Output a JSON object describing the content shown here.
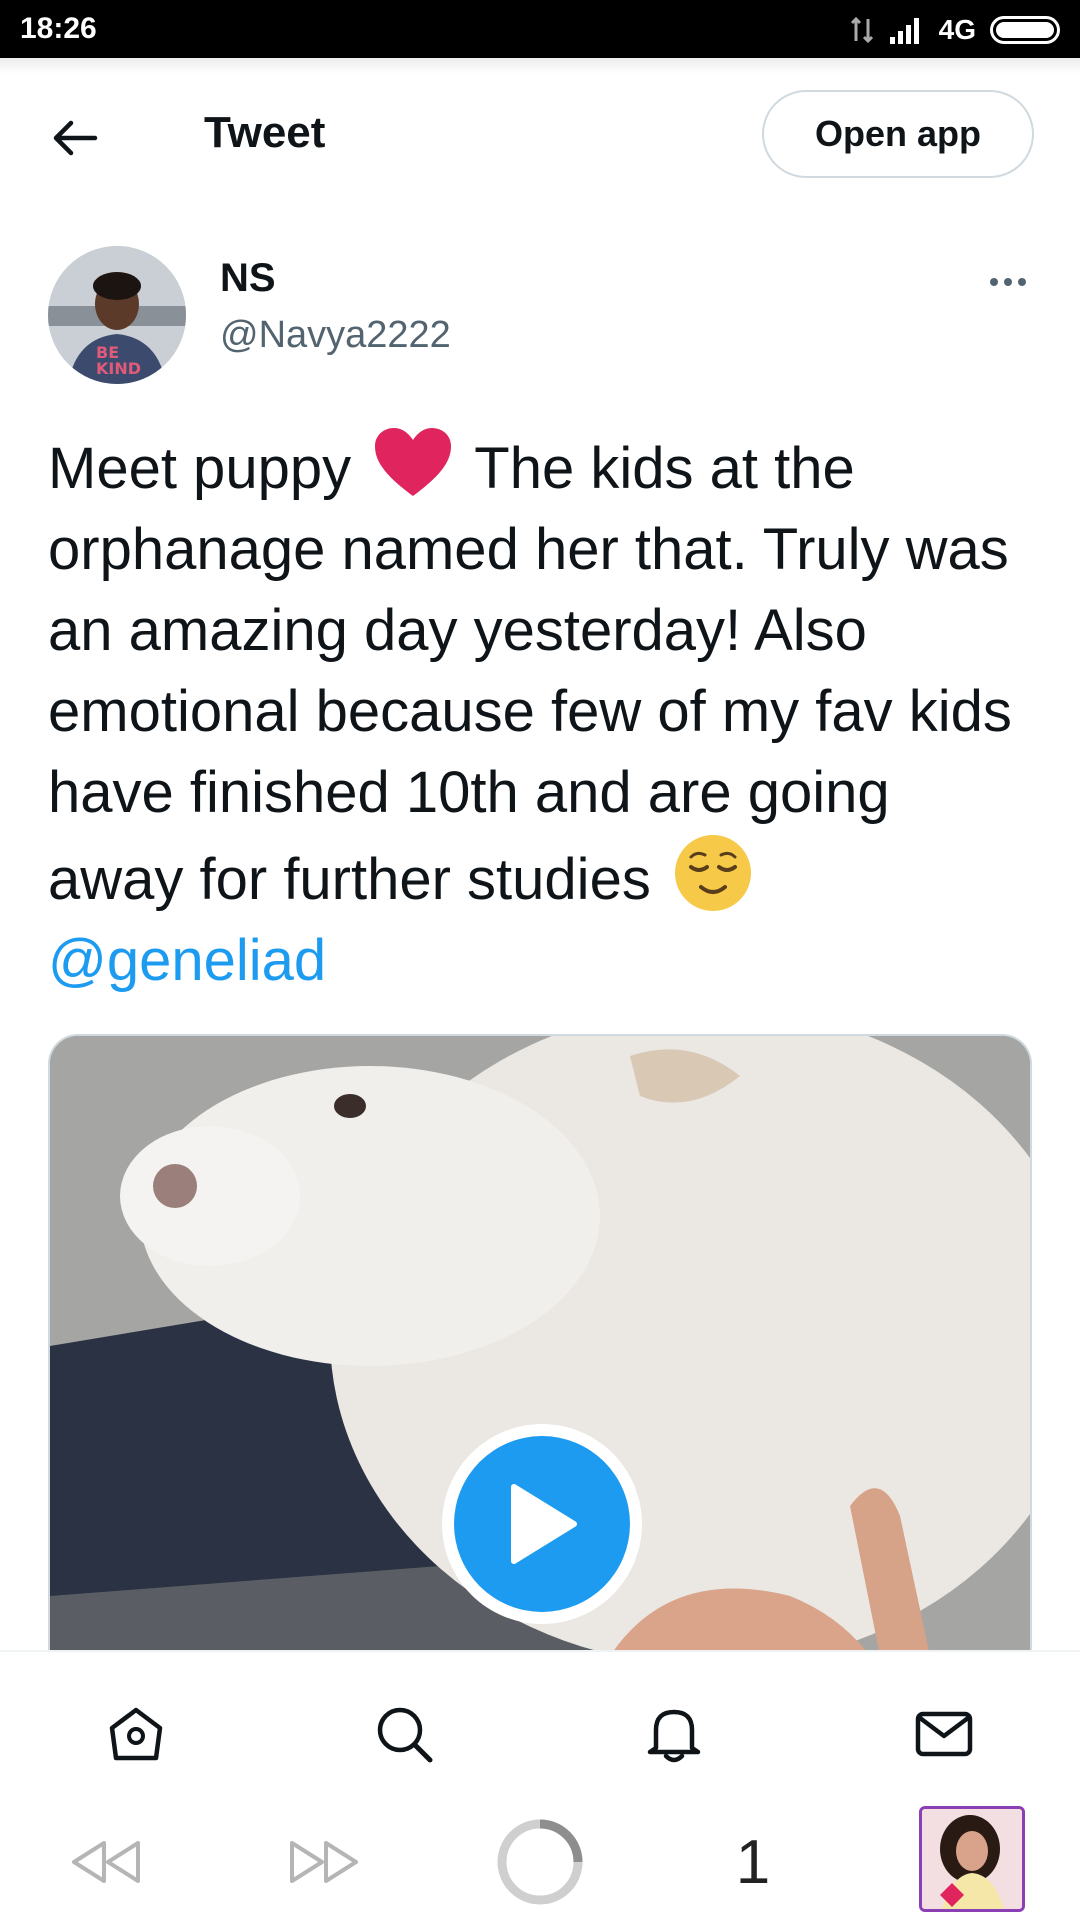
{
  "status_bar": {
    "time": "18:26",
    "network": "4G"
  },
  "header": {
    "title": "Tweet",
    "open_app_label": "Open app"
  },
  "author": {
    "name": "NS",
    "handle": "@Navya2222"
  },
  "tweet": {
    "text_part1": "Meet puppy",
    "text_part2": "The kids at the orphanage named her that. Truly was an amazing day yesterday! Also emotional because few of my fav kids have finished 10th and are going away for further studies",
    "mention": "@geneliad",
    "emojis": [
      "red-heart",
      "relieved-face"
    ]
  },
  "media": {
    "type": "video",
    "play_button_color": "#1d9bf0"
  },
  "tabbar": {
    "items": [
      "home-icon",
      "search-icon",
      "notifications-icon",
      "messages-icon"
    ]
  },
  "browser_nav": {
    "tab_count": "1",
    "items": [
      "back-icon",
      "forward-icon",
      "loading-icon",
      "tab-count",
      "profile-avatar"
    ]
  },
  "colors": {
    "accent": "#1d9bf0",
    "text_primary": "#0f1419",
    "text_secondary": "#536471",
    "heart": "#e0245e"
  }
}
